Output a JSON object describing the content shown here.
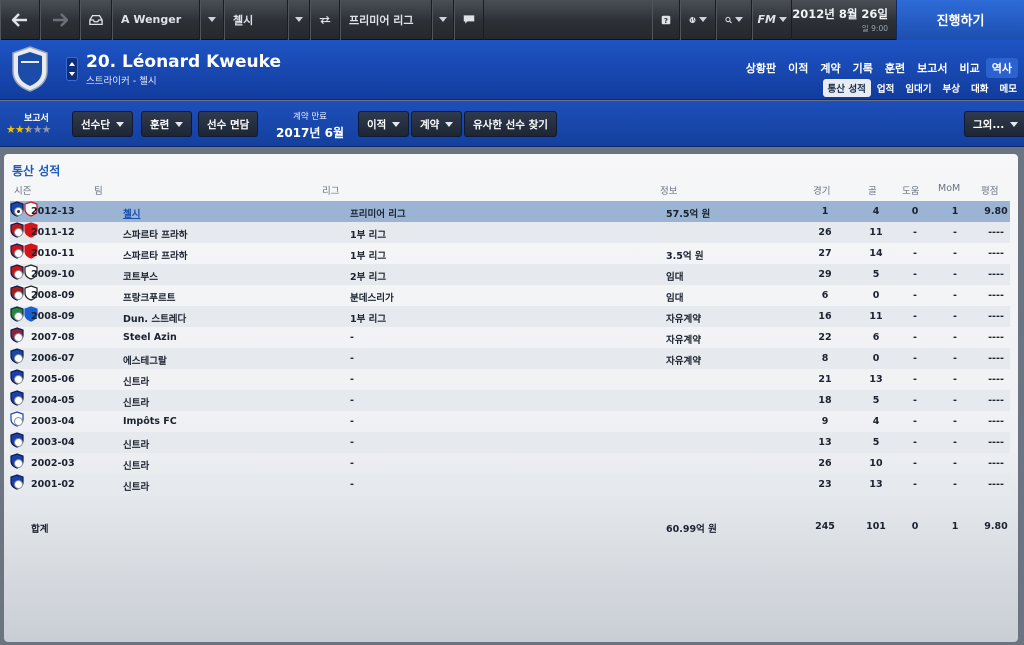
{
  "topbar": {
    "manager": "A Wenger",
    "club": "첼시",
    "competition": "프리미어 리그",
    "date": "2012년 8월 26일",
    "day_time": "일 9:00",
    "continue": "진행하기"
  },
  "player": {
    "name": "20. Léonard Kweuke",
    "subtitle": "스트라이커 - 첼시"
  },
  "main_tabs": [
    "상황판",
    "이적",
    "계약",
    "기록",
    "훈련",
    "보고서",
    "비교",
    "역사"
  ],
  "sub_tabs": [
    "통산 성적",
    "업적",
    "임대기",
    "부상",
    "대화",
    "메모"
  ],
  "toolbar": {
    "report_label": "보고서",
    "stars": "★★★★★",
    "squad": "선수단",
    "training": "훈련",
    "interview": "선수 면담",
    "contract_label": "계약 만료",
    "contract_date": "2017년 6월",
    "transfer": "이적",
    "contract": "계약",
    "similar": "유사한 선수 찾기",
    "other": "그외..."
  },
  "panel_title": "통산 성적",
  "columns": {
    "season": "시즌",
    "club": "팀",
    "league": "리그",
    "info": "정보",
    "apps": "경기",
    "goals": "골",
    "assists": "도움",
    "mom": "MoM",
    "rating": "평점"
  },
  "history": [
    {
      "season": "2012-13",
      "club": "첼시",
      "league": "프리미어 리그",
      "info": "57.5억 원",
      "apps": "1",
      "goals": "4",
      "assists": "0",
      "mom": "1",
      "rating": "9.80"
    },
    {
      "season": "2011-12",
      "club": "스파르타 프라하",
      "league": "1부 리그",
      "info": "",
      "apps": "26",
      "goals": "11",
      "assists": "-",
      "mom": "-",
      "rating": "----"
    },
    {
      "season": "2010-11",
      "club": "스파르타 프라하",
      "league": "1부 리그",
      "info": "3.5억 원",
      "apps": "27",
      "goals": "14",
      "assists": "-",
      "mom": "-",
      "rating": "----"
    },
    {
      "season": "2009-10",
      "club": "코트부스",
      "league": "2부 리그",
      "info": "임대",
      "apps": "29",
      "goals": "5",
      "assists": "-",
      "mom": "-",
      "rating": "----"
    },
    {
      "season": "2008-09",
      "club": "프랑크푸르트",
      "league": "분데스리가",
      "info": "임대",
      "apps": "6",
      "goals": "0",
      "assists": "-",
      "mom": "-",
      "rating": "----"
    },
    {
      "season": "2008-09",
      "club": "Dun. 스트레다",
      "league": "1부 리그",
      "info": "자유계약",
      "apps": "16",
      "goals": "11",
      "assists": "-",
      "mom": "-",
      "rating": "----"
    },
    {
      "season": "2007-08",
      "club": "Steel Azin",
      "league": "-",
      "info": "자유계약",
      "apps": "22",
      "goals": "6",
      "assists": "-",
      "mom": "-",
      "rating": "----"
    },
    {
      "season": "2006-07",
      "club": "에스테그랄",
      "league": "-",
      "info": "자유계약",
      "apps": "8",
      "goals": "0",
      "assists": "-",
      "mom": "-",
      "rating": "----"
    },
    {
      "season": "2005-06",
      "club": "신트라",
      "league": "-",
      "info": "",
      "apps": "21",
      "goals": "13",
      "assists": "-",
      "mom": "-",
      "rating": "----"
    },
    {
      "season": "2004-05",
      "club": "신트라",
      "league": "-",
      "info": "",
      "apps": "18",
      "goals": "5",
      "assists": "-",
      "mom": "-",
      "rating": "----"
    },
    {
      "season": "2003-04",
      "club": "Impôts FC",
      "league": "-",
      "info": "",
      "apps": "9",
      "goals": "4",
      "assists": "-",
      "mom": "-",
      "rating": "----"
    },
    {
      "season": "2003-04",
      "club": "신트라",
      "league": "-",
      "info": "",
      "apps": "13",
      "goals": "5",
      "assists": "-",
      "mom": "-",
      "rating": "----"
    },
    {
      "season": "2002-03",
      "club": "신트라",
      "league": "-",
      "info": "",
      "apps": "26",
      "goals": "10",
      "assists": "-",
      "mom": "-",
      "rating": "----"
    },
    {
      "season": "2001-02",
      "club": "신트라",
      "league": "-",
      "info": "",
      "apps": "23",
      "goals": "13",
      "assists": "-",
      "mom": "-",
      "rating": "----"
    }
  ],
  "totals": {
    "label": "합계",
    "info": "60.99억 원",
    "apps": "245",
    "goals": "101",
    "assists": "0",
    "mom": "1",
    "rating": "9.80"
  },
  "colors": {
    "header_blue": "#1e54c4",
    "selected_row": "#9bb4d4",
    "title_blue": "#1f5bb8",
    "star_gold": "#f2c200"
  }
}
